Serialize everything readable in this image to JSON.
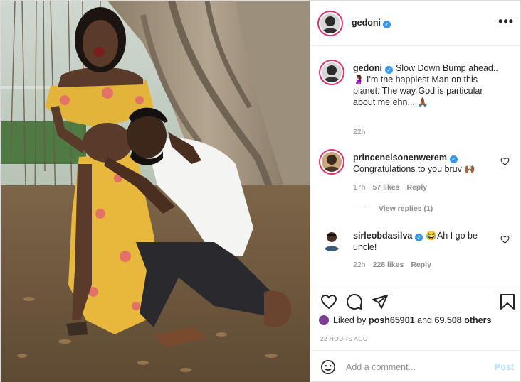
{
  "post": {
    "author": "gedoni",
    "more_label": "•••"
  },
  "caption": {
    "username": "gedoni",
    "text": "Slow Down Bump ahead.. 🤰🏾 I'm the happiest Man on this planet. The way God is particular about me ehn... 🙏🏾",
    "time": "22h"
  },
  "comments": [
    {
      "username": "princenelsonenwerem",
      "text": "Congratulations to you bruv 🙌🏾",
      "time": "17h",
      "likes": "57 likes",
      "reply": "Reply",
      "view_replies": "View replies (1)"
    },
    {
      "username": "sirleobdasilva",
      "text": "😂Ah I go be uncle!",
      "time": "22h",
      "likes": "228 likes",
      "reply": "Reply"
    }
  ],
  "likes": {
    "prefix": "Liked by",
    "user": "posh65901",
    "and": "and",
    "others": "69,508 others"
  },
  "timeago": "22 HOURS AGO",
  "comment_box": {
    "placeholder": "Add a comment...",
    "post_label": "Post"
  },
  "icons": {
    "heart": "heart-icon",
    "comment": "comment-icon",
    "share": "share-icon",
    "save": "bookmark-icon",
    "emoji": "emoji-icon",
    "verified": "verified-badge"
  },
  "colors": {
    "accent": "#3897f0",
    "story_ring": "#e1306c",
    "post_disabled": "#b2dffc",
    "muted": "#8e8e8e",
    "text": "#262626"
  }
}
